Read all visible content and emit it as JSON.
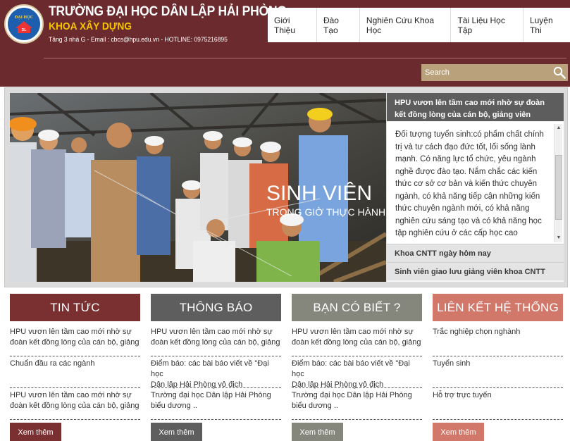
{
  "header": {
    "school_name": "TRƯỜNG ĐẠI HỌC DÂN LẬP HẢI PHÒNG",
    "faculty_name": "KHOA XÂY DỰNG",
    "contact": "Tầng 3 nhà G - Email : cbcs@hpu.edu.vn - HOTLINE: 0975216895",
    "logo_text": "ĐẠI HỌC",
    "logo_badge": "DL"
  },
  "nav": {
    "items": [
      "Giới Thiệu",
      "Đào Tạo",
      "Nghiên Cứu Khoa Học",
      "Tài Liệu Học Tập",
      "Luyện Thi"
    ]
  },
  "search": {
    "placeholder": "Search"
  },
  "slider": {
    "overlay_title": "SINH VIÊN",
    "overlay_subtitle": "TRONG GIỜ THỰC HÀNH",
    "active_title": "HPU vươn lên tầm cao mới nhờ sự đoàn kết đồng lòng của cán bộ, giảng viên",
    "active_body": "Đối tượng tuyển sinh:có phẩm chất chính trị và tư cách đạo đức tốt, lối sống lành mạnh. Có năng lực tổ chức, yêu ngành nghề được đào tạo. Nắm chắc các kiến thức cơ sở cơ bản và kiến thức chuyên ngành, có khả năng tiếp cận những kiến thức chuyên ngành mới, có khả năng nghiên cứu sáng tạo và có khả năng học tập nghiên cứu ở các cấp học cao",
    "items": [
      "Khoa CNTT ngày hôm nay",
      "Sinh viên giao lưu giảng viên khoa CNTT"
    ]
  },
  "columns": [
    {
      "title": "TIN TỨC",
      "color": "#7a2f31",
      "items": [
        [
          "HPU vươn lên tầm cao mới nhờ sự",
          "đoàn kết đồng lòng của cán bộ, giảng"
        ],
        [
          "Chuẩn đầu ra các ngành",
          ""
        ],
        [
          "HPU vươn lên tầm cao mới nhờ sự",
          "đoàn kết đồng lòng của cán bộ, giảng"
        ]
      ],
      "more": "Xem thêm"
    },
    {
      "title": "THÔNG BÁO",
      "color": "#5e5e5e",
      "items": [
        [
          "HPU vươn lên tầm cao mới nhờ sự",
          "đoàn kết đồng lòng của cán bộ, giảng"
        ],
        [
          "Điểm báo: các bài báo viết về \"Đại học",
          "Dân lập Hải Phòng vô địch"
        ],
        [
          "Trường đại học Dân lập Hải Phòng",
          "biểu dương .."
        ]
      ],
      "more": "Xem thêm"
    },
    {
      "title": "BẠN CÓ BIẾT ?",
      "color": "#85877d",
      "items": [
        [
          "HPU vươn lên tầm cao mới nhờ sự",
          "đoàn kết đồng lòng của cán bộ, giảng"
        ],
        [
          "Điểm báo: các bài báo viết về \"Đại học",
          "Dân lập Hải Phòng vô địch"
        ],
        [
          "Trường đại học Dân lập Hải Phòng",
          "biểu dương .."
        ]
      ],
      "more": "Xem thêm"
    },
    {
      "title": "LIÊN KẾT HỆ THỐNG",
      "color": "#d1786a",
      "items": [
        [
          "Trắc nghiệp chọn nghành",
          ""
        ],
        [
          "Tuyển sinh",
          ""
        ],
        [
          "Hỗ trợ trực tuyến",
          ""
        ]
      ],
      "more": "Xem thêm"
    }
  ]
}
